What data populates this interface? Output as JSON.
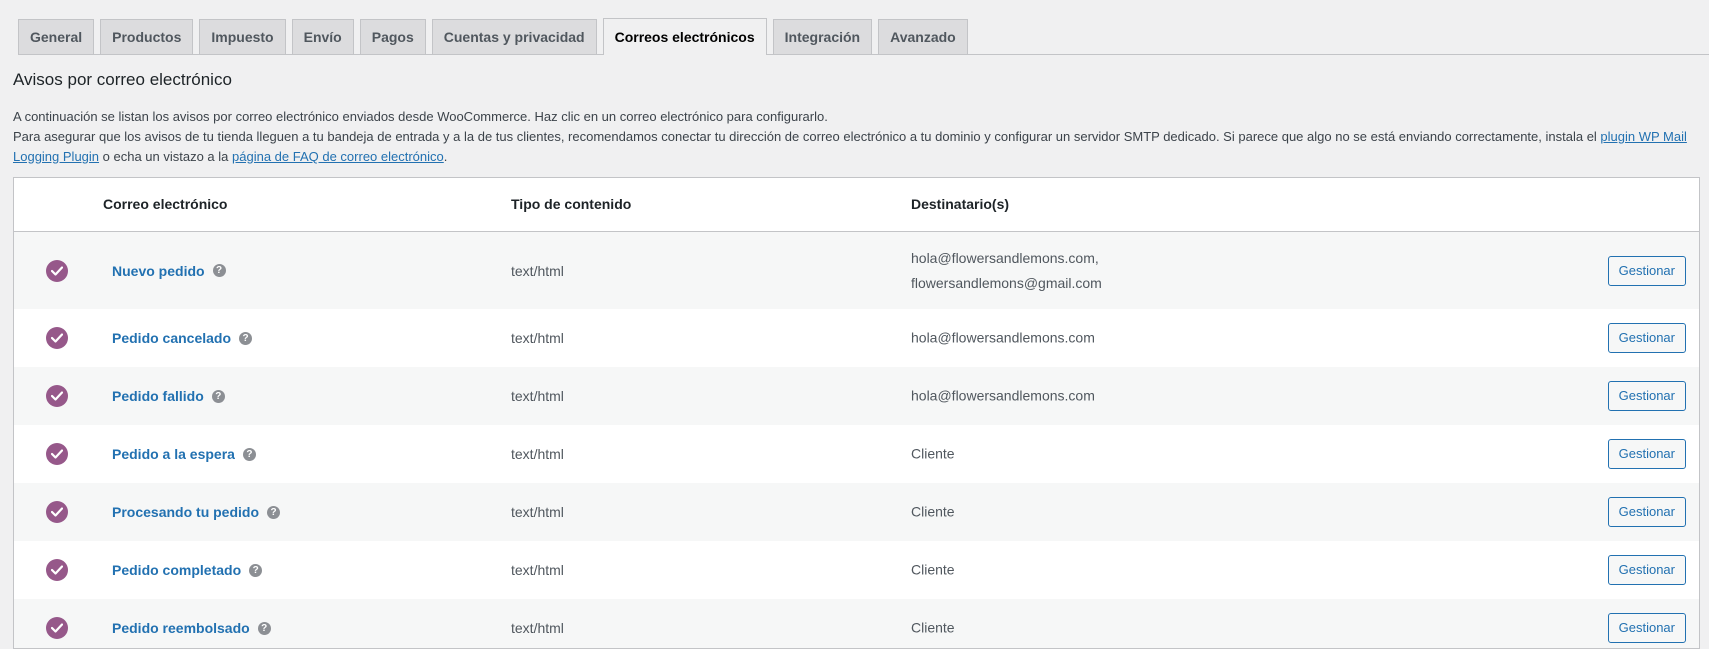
{
  "tabs": [
    {
      "label": "General",
      "active": false
    },
    {
      "label": "Productos",
      "active": false
    },
    {
      "label": "Impuesto",
      "active": false
    },
    {
      "label": "Envío",
      "active": false
    },
    {
      "label": "Pagos",
      "active": false
    },
    {
      "label": "Cuentas y privacidad",
      "active": false
    },
    {
      "label": "Correos electrónicos",
      "active": true
    },
    {
      "label": "Integración",
      "active": false
    },
    {
      "label": "Avanzado",
      "active": false
    }
  ],
  "page": {
    "heading": "Avisos por correo electrónico",
    "intro": "A continuación se listan los avisos por correo electrónico enviados desde WooCommerce. Haz clic en un correo electrónico para configurarlo.",
    "smtp_text_1": "Para asegurar que los avisos de tu tienda lleguen a tu bandeja de entrada y a la de tus clientes, recomendamos conectar tu dirección de correo electrónico a tu dominio y configurar un servidor SMTP dedicado. Si parece que algo no se está enviando correctamente, instala el ",
    "smtp_link_1": "plugin WP Mail Logging Plugin",
    "smtp_text_2": " o echa un vistazo a la ",
    "smtp_link_2": "página de FAQ de correo electrónico",
    "smtp_text_3": "."
  },
  "table": {
    "headers": {
      "email": "Correo electrónico",
      "content_type": "Tipo de contenido",
      "recipients": "Destinatario(s)"
    },
    "help_glyph": "?",
    "rows": [
      {
        "name": "Nuevo pedido",
        "content_type": "text/html",
        "recipients": [
          "hola@flowersandlemons.com,",
          "flowersandlemons@gmail.com"
        ],
        "manage": "Gestionar",
        "enabled": true
      },
      {
        "name": "Pedido cancelado",
        "content_type": "text/html",
        "recipients": [
          "hola@flowersandlemons.com"
        ],
        "manage": "Gestionar",
        "enabled": true
      },
      {
        "name": "Pedido fallido",
        "content_type": "text/html",
        "recipients": [
          "hola@flowersandlemons.com"
        ],
        "manage": "Gestionar",
        "enabled": true
      },
      {
        "name": "Pedido a la espera",
        "content_type": "text/html",
        "recipients": [
          "Cliente"
        ],
        "manage": "Gestionar",
        "enabled": true
      },
      {
        "name": "Procesando tu pedido",
        "content_type": "text/html",
        "recipients": [
          "Cliente"
        ],
        "manage": "Gestionar",
        "enabled": true
      },
      {
        "name": "Pedido completado",
        "content_type": "text/html",
        "recipients": [
          "Cliente"
        ],
        "manage": "Gestionar",
        "enabled": true
      },
      {
        "name": "Pedido reembolsado",
        "content_type": "text/html",
        "recipients": [
          "Cliente"
        ],
        "manage": "Gestionar",
        "enabled": true
      }
    ]
  },
  "colors": {
    "accent": "#2271b1",
    "enabled_icon": "#96588a"
  }
}
